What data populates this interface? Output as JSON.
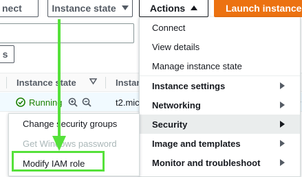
{
  "toolbar": {
    "connect_label": "nect",
    "instance_state_label": "Instance state",
    "actions_label": "Actions",
    "launch_label": "Launch instances"
  },
  "filter": {
    "s_label": "s"
  },
  "table": {
    "headers": [
      "Instance state",
      "Instan"
    ],
    "row": {
      "state": "Running",
      "type": "t2.mic"
    }
  },
  "actions_menu": {
    "items": [
      {
        "label": "Connect",
        "bold": false
      },
      {
        "label": "View details",
        "bold": false
      },
      {
        "label": "Manage instance state",
        "bold": false
      },
      {
        "label": "Instance settings",
        "bold": true,
        "submenu": true
      },
      {
        "label": "Networking",
        "bold": true,
        "submenu": true
      },
      {
        "label": "Security",
        "bold": true,
        "submenu": true,
        "active": true
      },
      {
        "label": "Image and templates",
        "bold": true,
        "submenu": true
      },
      {
        "label": "Monitor and troubleshoot",
        "bold": true,
        "submenu": true
      }
    ]
  },
  "security_submenu": {
    "items": [
      {
        "label": "Change security groups",
        "disabled": false
      },
      {
        "label": "Get Windows password",
        "disabled": true
      },
      {
        "label": "Modify IAM role",
        "disabled": false,
        "highlighted": true
      }
    ]
  },
  "colors": {
    "annotation": "#55e13a",
    "running": "#1d8102",
    "launch": "#ec7211"
  }
}
